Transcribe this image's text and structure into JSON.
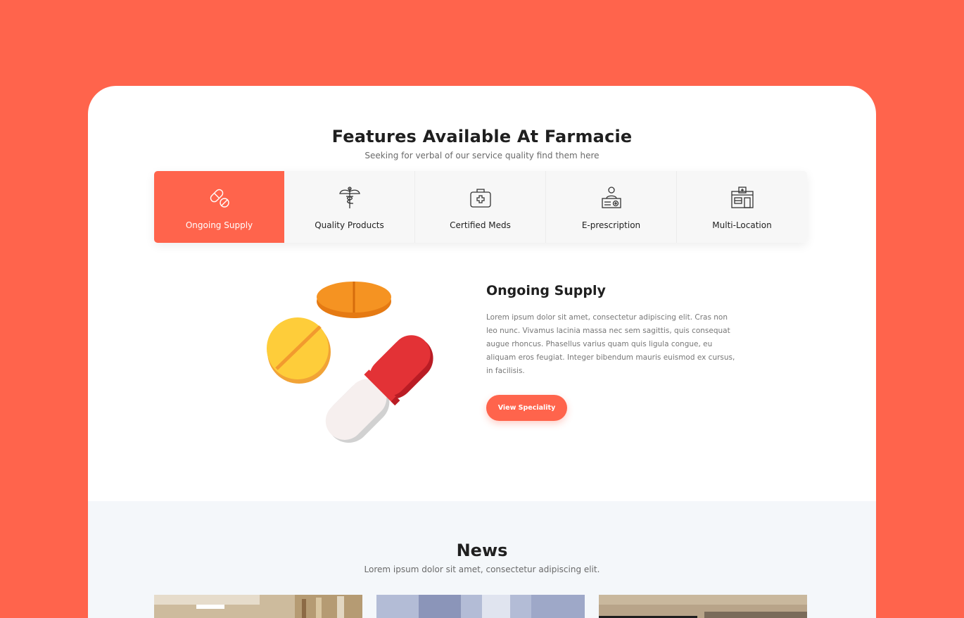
{
  "features": {
    "title": "Features Available At Farmacie",
    "subtitle": "Seeking for verbal of our service quality find them here",
    "tabs": [
      {
        "label": "Ongoing Supply",
        "icon": "pills-icon",
        "active": true
      },
      {
        "label": "Quality Products",
        "icon": "caduceus-icon",
        "active": false
      },
      {
        "label": "Certified Meds",
        "icon": "medical-kit-icon",
        "active": false
      },
      {
        "label": "E-prescription",
        "icon": "pharmacist-icon",
        "active": false
      },
      {
        "label": "Multi-Location",
        "icon": "pharmacy-store-icon",
        "active": false
      }
    ],
    "detail": {
      "title": "Ongoing Supply",
      "body": "Lorem ipsum dolor sit amet, consectetur adipiscing elit. Cras non leo nunc. Vivamus lacinia massa nec sem sagittis, quis consequat augue rhoncus. Phasellus varius quam quis ligula congue, eu aliquam eros feugiat. Integer bibendum mauris euismod ex cursus, in facilisis.",
      "button": "View Speciality",
      "illustration": "pills-capsule-illustration"
    }
  },
  "news": {
    "title": "News",
    "subtitle": "Lorem ipsum dolor sit amet, consectetur adipiscing elit."
  },
  "colors": {
    "accent": "#ff644c",
    "background": "#ff644c",
    "card": "#ffffff",
    "news_bg": "#f4f7fa"
  }
}
